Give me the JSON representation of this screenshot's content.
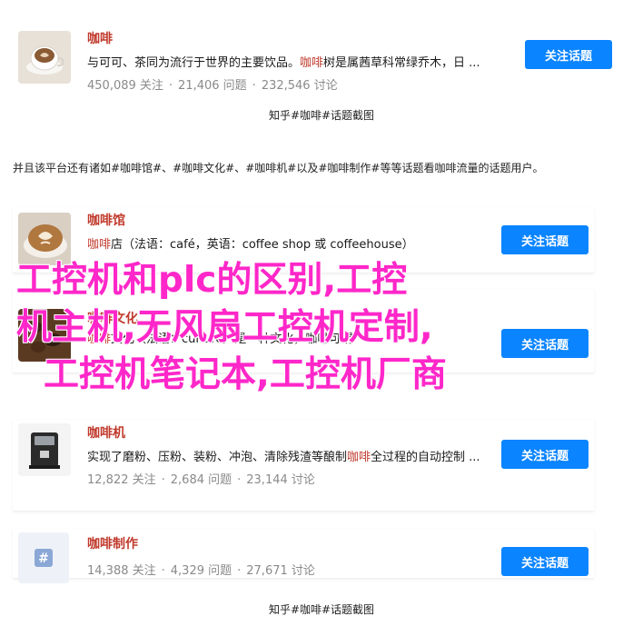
{
  "cards": [
    {
      "title": "咖啡",
      "desc_before": "与可可、茶同为流行于世界的主要饮品。",
      "desc_highlight": "咖啡",
      "desc_after": "树是属茜草科常绿乔木，日 ...",
      "followers": "450,089 关注",
      "questions": "21,406 问题",
      "discussions": "232,546 讨论",
      "button": "关注话题",
      "thumb_icon": "coffee-cup-icon"
    },
    {
      "title": "咖啡馆",
      "desc_before": "",
      "desc_highlight": "咖啡",
      "desc_after": "店（法语：café，英语：coffee shop 或 coffeehouse）",
      "button": "关注话题",
      "thumb_icon": "latte-art-icon"
    },
    {
      "title": "咖啡文化",
      "desc_before": "",
      "desc_highlight": "咖啡",
      "desc_after": "文化（法语：culture）是一种文化，咖啡可谓",
      "button": "关注话题",
      "thumb_icon": "coffee-beans-icon"
    },
    {
      "title": "咖啡机",
      "desc_before": "实现了磨粉、压粉、装粉、冲泡、清除残渣等酿制",
      "desc_highlight": "咖啡",
      "desc_after": "全过程的自动控制 ...",
      "followers": "12,822 关注",
      "questions": "2,684 问题",
      "discussions": "23,144 讨论",
      "button": "关注话题",
      "thumb_icon": "coffee-machine-icon"
    },
    {
      "title": "咖啡制作",
      "followers": "14,388 关注",
      "questions": "4,329 问题",
      "discussions": "27,671 讨论",
      "button": "关注话题",
      "thumb_icon": "hashtag-icon"
    }
  ],
  "caption_top": "知乎#咖啡#话题截图",
  "paragraph": "并且该平台还有诸如#咖啡馆#、#咖啡文化#、#咖啡机#以及#咖啡制作#等等话题看咖啡流量的话题用户。",
  "caption_bottom": "知乎#咖啡#话题截图",
  "overlay": {
    "line1": "工控机和plc的区别,工控",
    "line2": "机主机,无风扇工控机定制,",
    "line3": "工控机笔记本,工控机厂商"
  },
  "colors": {
    "accent_red": "#c0392b",
    "button_blue": "#0a84ff",
    "overlay_magenta": "#ff27c9"
  }
}
